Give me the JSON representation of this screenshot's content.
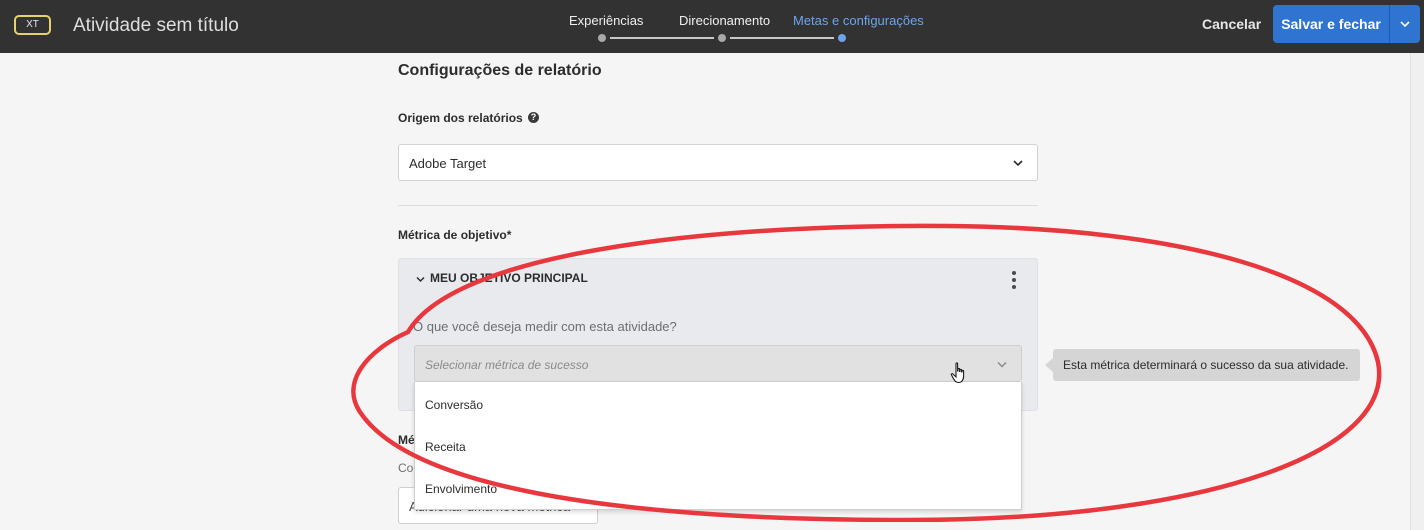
{
  "header": {
    "badge": "XT",
    "title": "Atividade sem título",
    "steps": [
      {
        "label": "Experiências",
        "active": false
      },
      {
        "label": "Direcionamento",
        "active": false
      },
      {
        "label": "Metas e configurações",
        "active": true
      }
    ],
    "cancel_label": "Cancelar",
    "save_label": "Salvar e fechar"
  },
  "reporting": {
    "section_title": "Configurações de relatório",
    "source_label": "Origem dos relatórios",
    "source_value": "Adobe Target"
  },
  "goal_metric": {
    "label": "Métrica de objetivo*",
    "card_title": "MEU OBJETIVO PRINCIPAL",
    "question": "O que você deseja medir com esta atividade?",
    "placeholder": "Selecionar métrica de sucesso",
    "options": [
      "Conversão",
      "Receita",
      "Envolvimento"
    ],
    "tooltip": "Esta métrica determinará o sucesso da sua atividade."
  },
  "additional": {
    "label": "Mé",
    "sub": "Co",
    "button_label": "Adicionar uma nova métrica"
  },
  "colors": {
    "accent": "#2f74d0",
    "active_step": "#6ea4ee",
    "annotation": "#e8383d"
  }
}
